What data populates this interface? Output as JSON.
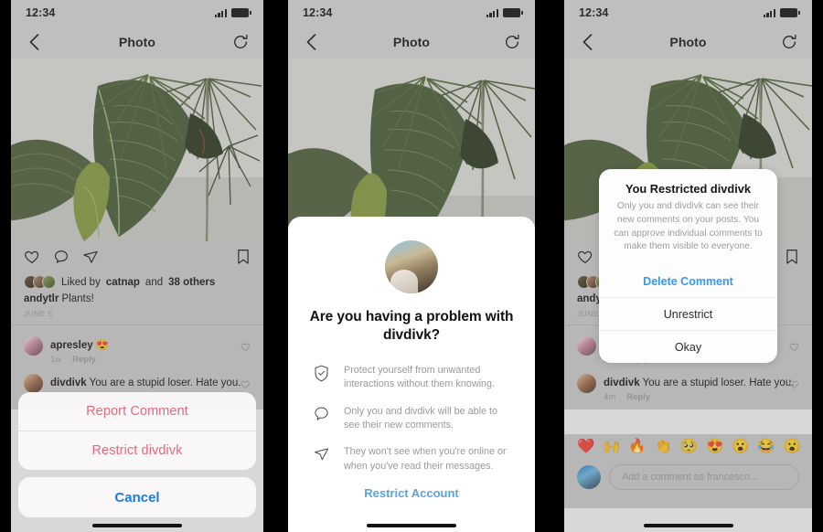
{
  "status_bar": {
    "time": "12:34",
    "signal_icon": "signal-bars-icon",
    "battery_icon": "battery-icon"
  },
  "nav": {
    "back_icon": "back-chevron-icon",
    "title": "Photo",
    "refresh_icon": "refresh-icon"
  },
  "post": {
    "like_icon": "heart-icon",
    "comment_icon": "comment-bubble-icon",
    "share_icon": "paper-plane-icon",
    "save_icon": "bookmark-icon",
    "liked_by_prefix": "Liked by ",
    "liked_by_user": "catnap",
    "liked_by_mid": " and ",
    "liked_by_count": "38 others",
    "caption_user": "andytlr",
    "caption_text": " Plants!",
    "date": "JUNE 5"
  },
  "comments": [
    {
      "avatar": "avatar-apresley",
      "user": "apresley",
      "text": " 😍",
      "time": "1w",
      "reply": "Reply",
      "like_icon": "heart-outline-icon"
    },
    {
      "avatar": "avatar-divdivk",
      "user": "divdivk",
      "text": " You are a stupid loser. Hate you.",
      "time": "4m",
      "reply": "Reply",
      "like_icon": "heart-outline-icon"
    }
  ],
  "action_sheet": {
    "report_label": "Report Comment",
    "restrict_label": "Restrict divdivk",
    "cancel_label": "Cancel",
    "destructive_color": "#e46a80",
    "cancel_color": "#1f7ae0"
  },
  "restrict_modal": {
    "avatar": "avatar-divdivk-large",
    "title": "Are you having a problem with divdivk?",
    "bullets": [
      {
        "icon": "shield-check-icon",
        "text": "Protect yourself from unwanted interactions without them knowing."
      },
      {
        "icon": "comment-bubble-icon",
        "text": "Only you and divdivk will be able to see their new comments."
      },
      {
        "icon": "paper-plane-icon",
        "text": "They won't see when you're online or when you've read their messages."
      }
    ],
    "cta_label": "Restrict Account",
    "cta_color": "#5aa3e0"
  },
  "restricted_alert": {
    "title": "You Restricted divdivk",
    "message": "Only you and divdivk can see their new comments on your posts. You can approve individual comments to make them visible to everyone.",
    "buttons": [
      {
        "label": "Delete Comment",
        "style": "primary"
      },
      {
        "label": "Unrestrict",
        "style": "default"
      },
      {
        "label": "Okay",
        "style": "default"
      }
    ],
    "primary_color": "#3897f0"
  },
  "composer": {
    "emojis": [
      "❤️",
      "🙌",
      "🔥",
      "👏",
      "🥺",
      "😍",
      "😮",
      "😂",
      "😮"
    ],
    "avatar": "avatar-francesco",
    "placeholder": "Add a comment as francesco..."
  }
}
